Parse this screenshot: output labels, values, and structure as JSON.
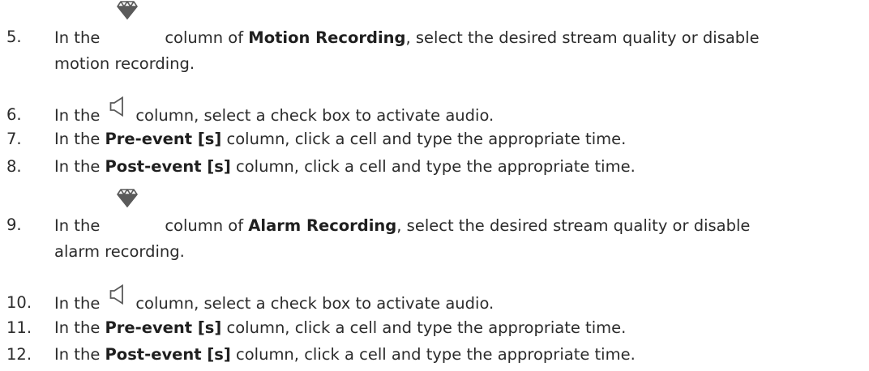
{
  "steps": [
    {
      "number": "5.",
      "pre": "In the",
      "icon": "diamond-quality-icon",
      "mid": "column of ",
      "bold": "Motion Recording",
      "post": ", select the desired stream quality or disable",
      "line2": "motion recording."
    },
    {
      "number": "6.",
      "pre": "In the",
      "icon": "speaker-audio-icon",
      "post": "column, select a check box to activate audio."
    },
    {
      "number": "7.",
      "pre": "In the ",
      "bold": "Pre-event [s]",
      "post": " column, click a cell and type the appropriate time."
    },
    {
      "number": "8.",
      "pre": "In the ",
      "bold": "Post-event [s]",
      "post": " column, click a cell and type the appropriate time."
    },
    {
      "number": "9.",
      "pre": "In the",
      "icon": "diamond-quality-icon",
      "mid": "column of ",
      "bold": "Alarm Recording",
      "post": ", select the desired stream quality or disable",
      "line2": "alarm recording."
    },
    {
      "number": "10.",
      "pre": "In the",
      "icon": "speaker-audio-icon",
      "post": "column, select a check box to activate audio."
    },
    {
      "number": "11.",
      "pre": "In the ",
      "bold": "Pre-event [s]",
      "post": " column, click a cell and type the appropriate time."
    },
    {
      "number": "12.",
      "pre": "In the ",
      "bold": "Post-event [s]",
      "post": " column, click a cell and type the appropriate time."
    }
  ],
  "colors": {
    "text": "#2b2b2b",
    "icon": "#5a5a5a"
  }
}
